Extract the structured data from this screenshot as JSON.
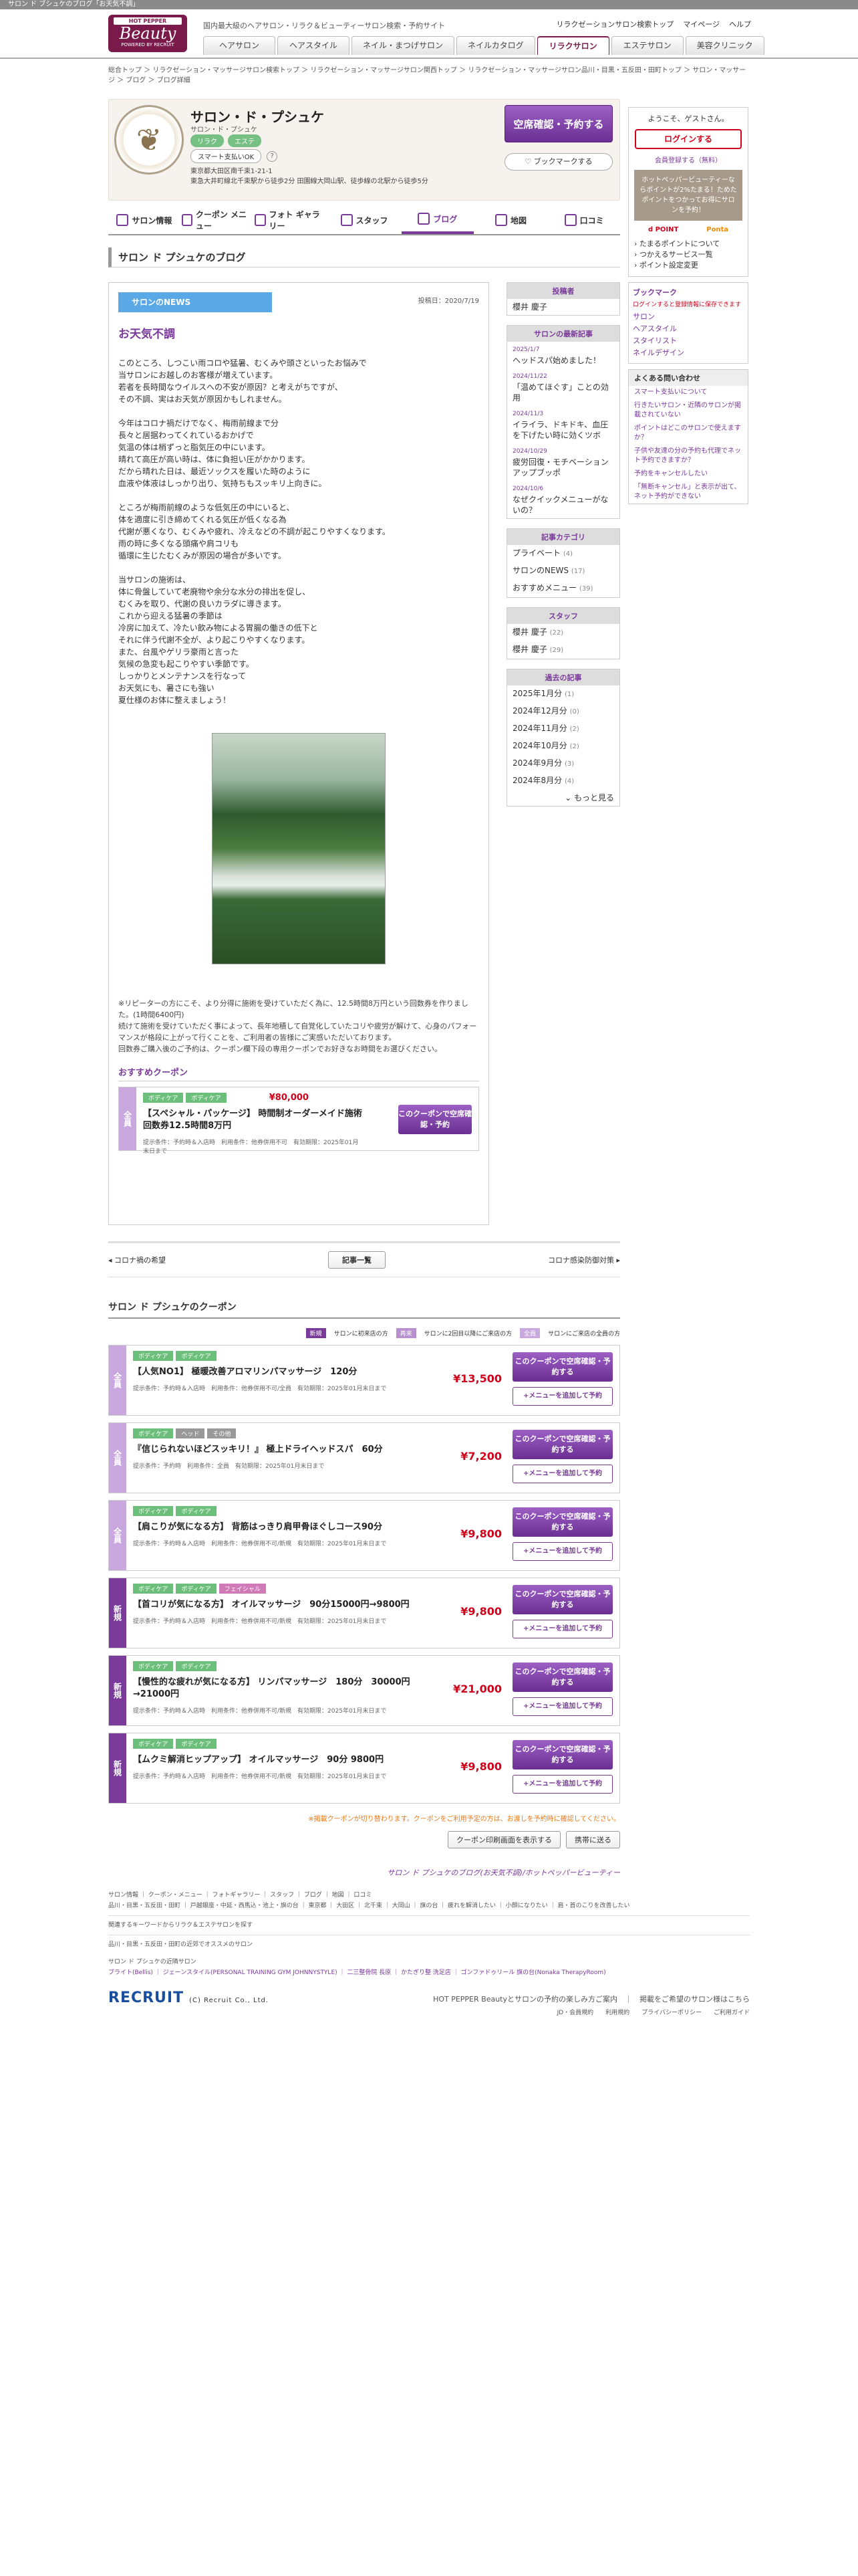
{
  "top_strip": "サロン ド ブシュケのブログ「お天気不調」",
  "logo": {
    "hp": "HOT PEPPER",
    "beauty": "Beauty",
    "powered": "POWERED BY RECRUIT"
  },
  "tagline": "国内最大級のヘアサロン・リラク＆ビューティーサロン検索・予約サイト",
  "top_links": [
    "リラクゼーションサロン検索トップ",
    "マイページ",
    "ヘルプ"
  ],
  "nav_tabs": [
    "ヘアサロン",
    "ヘアスタイル",
    "ネイル・まつげサロン",
    "ネイルカタログ",
    "リラクサロン",
    "エステサロン",
    "美容クリニック"
  ],
  "breadcrumb": "総合トップ ＞ リラクゼーション・マッサージサロン検索トップ ＞ リラクゼーション・マッサージサロン関西トップ ＞ リラクゼーション・マッサージサロン品川・目黒・五反田・田町トップ ＞ サロン・マッサージ ＞ ブログ ＞ ブログ詳細",
  "salon": {
    "name": "サロン・ド・プシュケ",
    "kana": "サロン・ド・プシュケ",
    "badges": [
      "リラク",
      "エステ"
    ],
    "smart_pay": "スマート支払いOK",
    "address_line1": "東京都大田区南千束1-21-1",
    "address_line2": "東急大井町線北千束駅から徒歩2分 田園線大岡山駅、徒歩線の北駅から徒歩5分",
    "reserve_label": "空席確認・予約する",
    "bookmark_label": "ブックマークする"
  },
  "salon_tabs": [
    "サロン情報",
    "クーポン メニュー",
    "フォト ギャラリー",
    "スタッフ",
    "ブログ",
    "地図",
    "口コミ"
  ],
  "section_title": "サロン ド プシュケのブログ",
  "blog": {
    "category": "サロンのNEWS",
    "date": "投稿日：2020/7/19",
    "title": "お天気不調",
    "body": "このところ、しつこい雨コロや猛暑、むくみや頭さといったお悩みで\n当サロンにお越しのお客様が増えています。\n若者を長時間なウイルスへの不安が原因？と考えがちですが、\nその不調、実はお天気が原因かもしれません。\n\n今年はコロナ禍だけでなく、梅雨前線まで分\n長々と居据わってくれているおかげで\n気温の体は梢ずっと脂気圧の中にいます。\n晴れて高圧が高い時は、体に負担い圧がかかります。\nだから晴れた日は、最近ソックスを履いた時のように\n血液や体液はしっかり出り、気持ちもスッキリ上向きに。\n\nところが梅雨前線のような低気圧の中にいると、\n体を適度に引き締めてくれる気圧が低くなる為\n代謝が悪くなり、むくみや疲れ、冷えなどの不調が起こりやすくなります。\n雨の時に多くなる頭痛や肩コリも\n循環に生じたむくみが原因の場合が多いです。\n\n当サロンの施術は、\n体に骨盤していて老廃物や余分な水分の排出を促し、\nむくみを取り、代謝の良いカラダに導きます。\nこれから迎える猛暑の季節は\n冷房に加えて、冷たい飲み物による胃腸の働きの低下と\nそれに伴う代謝不全が、より起こりやすくなります。\nまた、台風やゲリラ豪雨と言った\n気候の急変も起こりやすい季節です。\nしっかりとメンテナンスを行なって\nお天気にも、暑さにも強い\n夏仕様のお体に整えましょう！",
    "footer": "※リピーターの方にこそ、より分得に施術を受けていただく為に、12.5時間8万円という回数券を作りました。(1時間6400円)\n続けて施術を受けていただく事によって、長年地積して自覚化していたコリや疲労が解けて、心身のパフォーマンスが格段に上がって行くことを、ご利用者の皆様にご実感いただいております。\n回数券ご購入後のご予約は、クーポン欄下段の専用クーポンでお好きなお時間をお選びください。",
    "rec_coupon_heading": "おすすめクーポン"
  },
  "rec_coupon": {
    "side": "全員",
    "tags": [
      "ボディケア",
      "ボディケア"
    ],
    "price": "¥80,000",
    "name": "【スペシャル・パッケージ】 時間制オーダーメイド施術回数券12.5時間8万円",
    "meta": "提示条件：予約時＆入店時　利用条件：他券併用不可　有効期限：2025年01月末日まで",
    "btn": "このクーポンで空席確認・予約"
  },
  "pager": {
    "prev": "コロナ禍の希望",
    "list": "記事一覧",
    "next": "コロナ感染防御対策"
  },
  "coupons_title": "サロン ド プシュケのクーポン",
  "legend": [
    {
      "tag": "新規",
      "text": "サロンに初来店の方"
    },
    {
      "tag": "再来",
      "text": "サロンに2回目以降にご来店の方"
    },
    {
      "tag": "全員",
      "text": "サロンにご来店の全員の方"
    }
  ],
  "coupons": [
    {
      "side": "全員",
      "kind": "all",
      "tags": [
        "ボディケア",
        "ボディケア"
      ],
      "name": "【人気NO1】 極暖改善アロマリンパマッサージ　120分",
      "price": "¥13,500",
      "meta": "提示条件：予約時＆入店時　利用条件：他券併用不可/全員　有効期限：2025年01月末日まで"
    },
    {
      "side": "全員",
      "kind": "all",
      "tags": [
        "ボディケア",
        "ヘッド",
        "その他"
      ],
      "name": "『信じられないほどスッキリ！』 極上ドライヘッドスパ　60分",
      "price": "¥7,200",
      "meta": "提示条件：予約時　利用条件：全員　有効期限：2025年01月末日まで"
    },
    {
      "side": "全員",
      "kind": "all",
      "tags": [
        "ボディケア",
        "ボディケア"
      ],
      "name": "【肩こりが気になる方】 背筋はっきり肩甲骨ほぐしコース90分",
      "price": "¥9,800",
      "meta": "提示条件：予約時＆入店時　利用条件：他券併用不可/新規　有効期限：2025年01月末日まで"
    },
    {
      "side": "新規",
      "kind": "new",
      "tags": [
        "ボディケア",
        "ボディケア",
        "フェイシャル"
      ],
      "name": "【首コリが気になる方】 オイルマッサージ　90分15000円→9800円",
      "price": "¥9,800",
      "meta": "提示条件：予約時＆入店時　利用条件：他券併用不可/新規　有効期限：2025年01月末日まで"
    },
    {
      "side": "新規",
      "kind": "new",
      "tags": [
        "ボディケア",
        "ボディケア"
      ],
      "name": "【慢性的な疲れが気になる方】 リンパマッサージ　180分　30000円→21000円",
      "price": "¥21,000",
      "meta": "提示条件：予約時＆入店時　利用条件：他券併用不可/新規　有効期限：2025年01月末日まで"
    },
    {
      "side": "新規",
      "kind": "new",
      "tags": [
        "ボディケア",
        "ボディケア"
      ],
      "name": "【ムクミ解消ヒップアップ】 オイルマッサージ　90分 9800円",
      "price": "¥9,800",
      "meta": "提示条件：予約時＆入店時　利用条件：他券併用不可/新規　有効期限：2025年01月末日まで"
    }
  ],
  "coupon_btn": "このクーポンで空席確認・予約する",
  "coupon_btn2": "+メニューを追加して予約",
  "warn": "※掲載クーポンが切り替わります。クーポンをご利用予定の方は、お渡しを予約時に確認してください。",
  "bottom_btns": [
    "クーポン印刷画面を表示する",
    "携帯に送る"
  ],
  "site_link": "サロン ド プシュケのブログ(お天気不調)/ホットペッパービューティー",
  "sidebar": {
    "author_title": "投稿者",
    "author": "櫻井 慶子",
    "latest_title": "サロンの最新記事",
    "latest": [
      {
        "date": "2025/1/7",
        "title": "ヘッドスパ始めました！"
      },
      {
        "date": "2024/11/22",
        "title": "「温めてほぐす」ことの効用"
      },
      {
        "date": "2024/11/3",
        "title": "イライラ、ドキドキ、血圧を下げたい時に効くツボ"
      },
      {
        "date": "2024/10/29",
        "title": "疲労回復・モチベーションアップブッポ"
      },
      {
        "date": "2024/10/6",
        "title": "なぜクイックメニューがないの？"
      }
    ],
    "cat_title": "記事カテゴリ",
    "cats": [
      {
        "name": "プライベート",
        "n": "(4)"
      },
      {
        "name": "サロンのNEWS",
        "n": "(17)"
      },
      {
        "name": "おすすめメニュー",
        "n": "(39)"
      }
    ],
    "staff_title": "スタッフ",
    "staff": [
      {
        "name": "櫻井 慶子",
        "n": "(22)"
      },
      {
        "name": "櫻井 慶子",
        "n": "(29)"
      }
    ],
    "past_title": "過去の記事",
    "past": [
      {
        "name": "2025年1月分",
        "n": "(1)"
      },
      {
        "name": "2024年12月分",
        "n": "(0)"
      },
      {
        "name": "2024年11月分",
        "n": "(2)"
      },
      {
        "name": "2024年10月分",
        "n": "(2)"
      },
      {
        "name": "2024年9月分",
        "n": "(3)"
      },
      {
        "name": "2024年8月分",
        "n": "(4)"
      }
    ],
    "more": "もっと見る"
  },
  "right": {
    "welcome": "ようこそ、ゲストさん。",
    "login": "ログインする",
    "register": "会員登録する（無料）",
    "point_text": "ホットペッパービューティーならポイントが2%たまる！ためたポイントをつかってお得にサロンを予約！",
    "plogos": [
      "Ponta",
      "Ponta"
    ],
    "links": [
      "たまるポイントについて",
      "つかえるサービス一覧",
      "ポイント設定変更"
    ],
    "bm_title": "ブックマーク",
    "bm_note": "ログインすると登録情報に保存できます",
    "bm_items": [
      "サロン",
      "ヘアスタイル",
      "スタイリスト",
      "ネイルデザイン"
    ],
    "faq_title": "よくある問い合わせ",
    "faq": [
      "スマート支払いについて",
      "行きたいサロン・近隣のサロンが掲載されていない",
      "ポイントはどこのサロンで使えますか？",
      "子供や友達の分の予約も代理でネット予約できますか？",
      "予約をキャンセルしたい",
      "「無断キャンセル」と表示が出て、ネット予約ができない"
    ]
  },
  "footer": {
    "row1": "サロン情報 ｜ クーポン・メニュー ｜ フォトギャラリー ｜ スタッフ ｜ ブログ ｜ 地図 ｜ 口コミ",
    "row2": "品川・目黒・五反田・田町 ｜ 戸越銀座・中延・西馬込・池上・旗の台 ｜ 東京都 ｜ 大田区 ｜ 北千束 ｜ 大岡山 ｜ 旗の台 ｜ 疲れを解消したい ｜ 小顔になりたい ｜ 肩・首のこりを改善したい",
    "row3": "関連するキーワードからリラク＆エステサロンを探す",
    "row4": "品川・目黒・五反田・田町の近郊でオススメのサロン",
    "row5": "サロン ド プシュケの近隣サロン",
    "row6": "ブライト(Bellis) ｜ ジェーンスタイル(PERSONAL TRAINING GYM JOHNNYSTYLE) ｜ 二三整骨院 長原 ｜ かたぎり整 洗足店 ｜ ゴンファドゥリール 旗の台(Nonaka TherapyRoom)",
    "recruit": "RECRUIT",
    "copy": "(C) Recruit Co., Ltd.",
    "r1": "HOT PEPPER Beautyとサロンの予約の楽しみ方ご案内　｜　掲載をご希望のサロン様はこちら",
    "r2": "JD・会員規約　　利用規約　　プライバシーポリシー　　ご利用ガイド"
  }
}
